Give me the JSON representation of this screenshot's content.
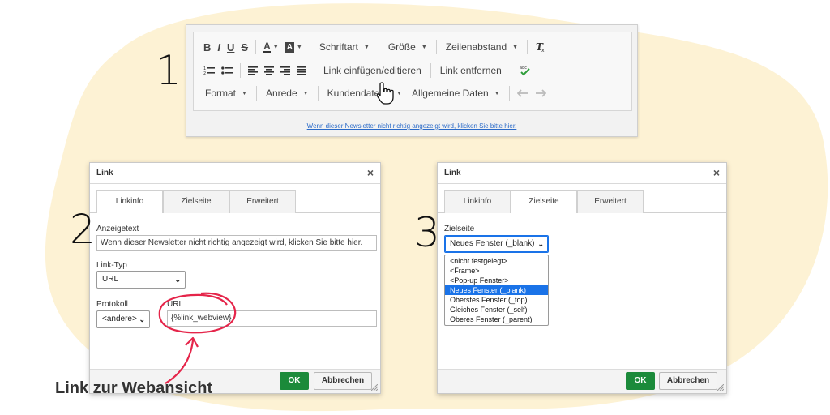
{
  "background": {
    "blob_color": "#fdf2d4"
  },
  "steps": {
    "one": "1",
    "two": "2",
    "three": "3"
  },
  "toolbar": {
    "bold": "B",
    "italic": "I",
    "underline": "U",
    "strike": "S",
    "text_color": "A",
    "bg_color": "A",
    "font": "Schriftart",
    "size": "Größe",
    "line_height": "Zeilenabstand",
    "insert_link": "Link einfügen/editieren",
    "remove_link": "Link entfernen",
    "format": "Format",
    "salutation": "Anrede",
    "customer_data": "Kundendaten",
    "general_data": "Allgemeine Daten"
  },
  "editor": {
    "footer_link": "Wenn dieser Newsletter nicht richtig angezeigt wird, klicken Sie bitte hier."
  },
  "dialog1": {
    "title": "Link",
    "close": "×",
    "tabs": [
      "Linkinfo",
      "Zielseite",
      "Erweitert"
    ],
    "display_text_label": "Anzeigetext",
    "display_text_value": "Wenn dieser Newsletter nicht richtig angezeigt wird, klicken Sie bitte hier.",
    "link_type_label": "Link-Typ",
    "link_type_value": "URL",
    "protocol_label": "Protokoll",
    "protocol_value": "<andere>",
    "url_label": "URL",
    "url_value": "{%link_webview}",
    "ok": "OK",
    "cancel": "Abbrechen"
  },
  "dialog2": {
    "title": "Link",
    "close": "×",
    "tabs": [
      "Linkinfo",
      "Zielseite",
      "Erweitert"
    ],
    "target_label": "Zielseite",
    "target_value": "Neues Fenster (_blank)",
    "options": [
      "<nicht festgelegt>",
      "<Frame>",
      "<Pop-up Fenster>",
      "Neues Fenster (_blank)",
      "Oberstes Fenster (_top)",
      "Gleiches Fenster (_self)",
      "Oberes Fenster (_parent)"
    ],
    "selected_index": 3,
    "ok": "OK",
    "cancel": "Abbrechen"
  },
  "annotation": {
    "label": "Link zur Webansicht",
    "color": "#e5254a"
  }
}
